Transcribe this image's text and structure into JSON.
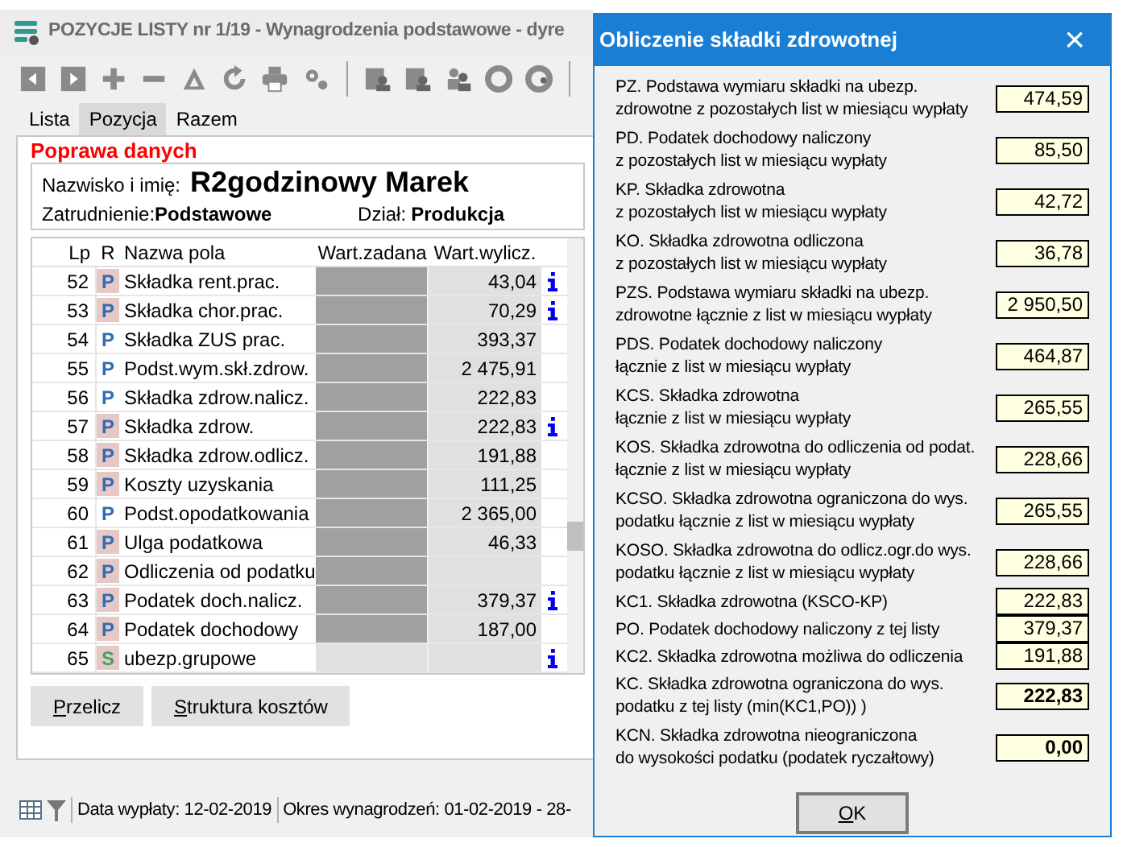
{
  "window": {
    "title": "POZYCJE LISTY nr 1/19 - Wynagrodzenia podstawowe - dyre"
  },
  "tabs": [
    {
      "label": "Lista",
      "selected": false
    },
    {
      "label": "Pozycja",
      "selected": true
    },
    {
      "label": "Razem",
      "selected": false
    }
  ],
  "section_title": "Poprawa danych",
  "employee": {
    "name_label": "Nazwisko i imię:",
    "name": "R2godzinowy Marek",
    "employment_label": "Zatrudnienie:",
    "employment": "Podstawowe",
    "department_label": "Dział:",
    "department": "Produkcja"
  },
  "table": {
    "columns": [
      "Lp",
      "R",
      "Nazwa pola",
      "Wart.zadana",
      "Wart.wylicz."
    ],
    "rows": [
      {
        "lp": "52",
        "kind": "P",
        "flagged": true,
        "name": "Składka rent.prac.",
        "computed": "43,04",
        "info": true
      },
      {
        "lp": "53",
        "kind": "P",
        "flagged": true,
        "name": "Składka chor.prac.",
        "computed": "70,29",
        "info": true
      },
      {
        "lp": "54",
        "kind": "P",
        "flagged": false,
        "name": "Składka ZUS prac.",
        "computed": "393,37",
        "info": false
      },
      {
        "lp": "55",
        "kind": "P",
        "flagged": false,
        "name": "Podst.wym.skł.zdrow.",
        "computed": "2 475,91",
        "info": false
      },
      {
        "lp": "56",
        "kind": "P",
        "flagged": false,
        "name": "Składka zdrow.nalicz.",
        "computed": "222,83",
        "info": false
      },
      {
        "lp": "57",
        "kind": "P",
        "flagged": true,
        "name": "Składka zdrow.",
        "computed": "222,83",
        "info": true
      },
      {
        "lp": "58",
        "kind": "P",
        "flagged": true,
        "name": "Składka zdrow.odlicz.",
        "computed": "191,88",
        "info": false
      },
      {
        "lp": "59",
        "kind": "P",
        "flagged": true,
        "name": "Koszty uzyskania",
        "computed": "111,25",
        "info": false
      },
      {
        "lp": "60",
        "kind": "P",
        "flagged": false,
        "name": "Podst.opodatkowania",
        "computed": "2 365,00",
        "info": false
      },
      {
        "lp": "61",
        "kind": "P",
        "flagged": true,
        "name": "Ulga podatkowa",
        "computed": "46,33",
        "info": false
      },
      {
        "lp": "62",
        "kind": "P",
        "flagged": true,
        "name": "Odliczenia od podatku",
        "info": false
      },
      {
        "lp": "63",
        "kind": "P",
        "flagged": true,
        "name": "Podatek doch.nalicz.",
        "computed": "379,37",
        "info": true
      },
      {
        "lp": "64",
        "kind": "P",
        "flagged": true,
        "name": "Podatek dochodowy",
        "computed": "187,00",
        "info": false
      },
      {
        "lp": "65",
        "kind": "S",
        "flagged": true,
        "name": "ubezp.grupowe",
        "info": true
      }
    ]
  },
  "buttons": [
    {
      "label": "Przelicz"
    },
    {
      "label": "Struktura kosztów"
    }
  ],
  "status_bar": [
    "Data wypłaty: 12-02-2019",
    "Okres wynagrodzeń: 01-02-2019 - 28-"
  ],
  "dialog": {
    "title": "Obliczenie składki zdrowotnej",
    "close": "×",
    "items": [
      {
        "lines": [
          "PZ. Podstawa wymiaru składki na ubezp.",
          "zdrowotne z pozostałych list w miesiącu wypłaty"
        ],
        "value": "474,59",
        "bold": false
      },
      {
        "lines": [
          "PD. Podatek dochodowy naliczony",
          "z pozostałych list w miesiącu wypłaty"
        ],
        "value": "85,50",
        "bold": false
      },
      {
        "lines": [
          "KP. Składka zdrowotna",
          "z pozostałych list w miesiącu wypłaty"
        ],
        "value": "42,72",
        "bold": false
      },
      {
        "lines": [
          "KO. Składka zdrowotna odliczona",
          "z pozostałych list w miesiącu wypłaty"
        ],
        "value": "36,78",
        "bold": false
      },
      {
        "lines": [
          "PZS. Podstawa wymiaru składki na ubezp.",
          "zdrowotne łącznie z list w miesiącu wypłaty"
        ],
        "value": "2 950,50",
        "bold": false
      },
      {
        "lines": [
          "PDS. Podatek dochodowy naliczony",
          "łącznie z list w miesiącu wypłaty"
        ],
        "value": "464,87",
        "bold": false
      },
      {
        "lines": [
          "KCS. Składka zdrowotna",
          "łącznie z list w miesiącu wypłaty"
        ],
        "value": "265,55",
        "bold": false
      },
      {
        "lines": [
          "KOS. Składka zdrowotna do odliczenia od podat.",
          "łącznie z list w miesiącu wypłaty"
        ],
        "value": "228,66",
        "bold": false
      },
      {
        "lines": [
          "KCSO. Składka zdrowotna ograniczona do wys.",
          "podatku łącznie z list w miesiącu wypłaty"
        ],
        "value": "265,55",
        "bold": false
      },
      {
        "lines": [
          "KOSO. Składka zdrowotna do odlicz.ogr.do wys.",
          "podatku łącznie z list w miesiącu wypłaty"
        ],
        "value": "228,66",
        "bold": false
      },
      {
        "lines": [
          "KC1. Składka zdrowotna (KSCO-KP)"
        ],
        "value": "222,83",
        "bold": false
      },
      {
        "lines": [
          "PO. Podatek dochodowy naliczony z tej listy"
        ],
        "value": "379,37",
        "bold": false
      },
      {
        "lines": [
          "KC2. Składka zdrowotna możliwa do odliczenia"
        ],
        "value": "191,88",
        "bold": false
      },
      {
        "lines": [
          "KC. Składka zdrowotna ograniczona do wys.",
          "podatku z tej listy (min(KC1,PO)) )"
        ],
        "value": "222,83",
        "bold": true
      },
      {
        "lines": [
          "KCN. Składka zdrowotna nieograniczona",
          "do wysokości podatku (podatek ryczałtowy)"
        ],
        "value": "0,00",
        "bold": true
      }
    ],
    "ok": {
      "label": "OK"
    }
  }
}
